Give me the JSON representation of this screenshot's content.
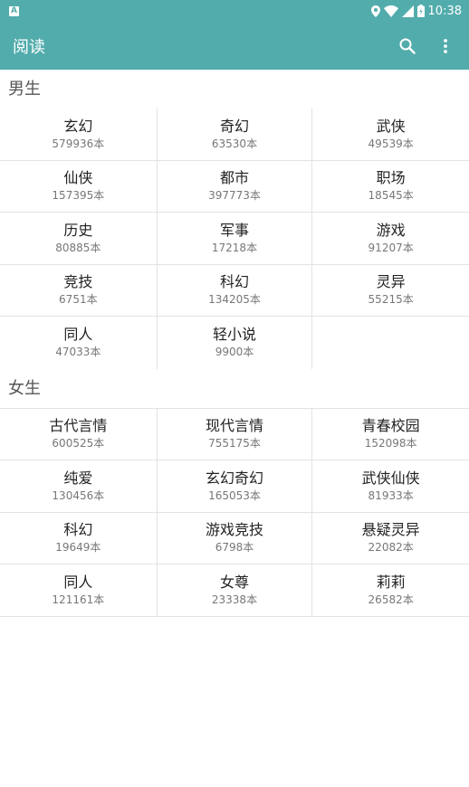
{
  "status_bar": {
    "notification": "A",
    "time": "10:38",
    "colors": {
      "bar": "#53acac"
    }
  },
  "app_bar": {
    "title": "阅读",
    "actions": [
      "search-icon",
      "more-vert-icon"
    ]
  },
  "sections": [
    {
      "title": "男生",
      "items": [
        {
          "name": "玄幻",
          "count": "579936本"
        },
        {
          "name": "奇幻",
          "count": "63530本"
        },
        {
          "name": "武侠",
          "count": "49539本"
        },
        {
          "name": "仙侠",
          "count": "157395本"
        },
        {
          "name": "都市",
          "count": "397773本"
        },
        {
          "name": "职场",
          "count": "18545本"
        },
        {
          "name": "历史",
          "count": "80885本"
        },
        {
          "name": "军事",
          "count": "17218本"
        },
        {
          "name": "游戏",
          "count": "91207本"
        },
        {
          "name": "竞技",
          "count": "6751本"
        },
        {
          "name": "科幻",
          "count": "134205本"
        },
        {
          "name": "灵异",
          "count": "55215本"
        },
        {
          "name": "同人",
          "count": "47033本"
        },
        {
          "name": "轻小说",
          "count": "9900本"
        }
      ]
    },
    {
      "title": "女生",
      "items": [
        {
          "name": "古代言情",
          "count": "600525本"
        },
        {
          "name": "现代言情",
          "count": "755175本"
        },
        {
          "name": "青春校园",
          "count": "152098本"
        },
        {
          "name": "纯爱",
          "count": "130456本"
        },
        {
          "name": "玄幻奇幻",
          "count": "165053本"
        },
        {
          "name": "武侠仙侠",
          "count": "81933本"
        },
        {
          "name": "科幻",
          "count": "19649本"
        },
        {
          "name": "游戏竞技",
          "count": "6798本"
        },
        {
          "name": "悬疑灵异",
          "count": "22082本"
        },
        {
          "name": "同人",
          "count": "121161本"
        },
        {
          "name": "女尊",
          "count": "23338本"
        },
        {
          "name": "莉莉",
          "count": "26582本"
        }
      ]
    }
  ]
}
